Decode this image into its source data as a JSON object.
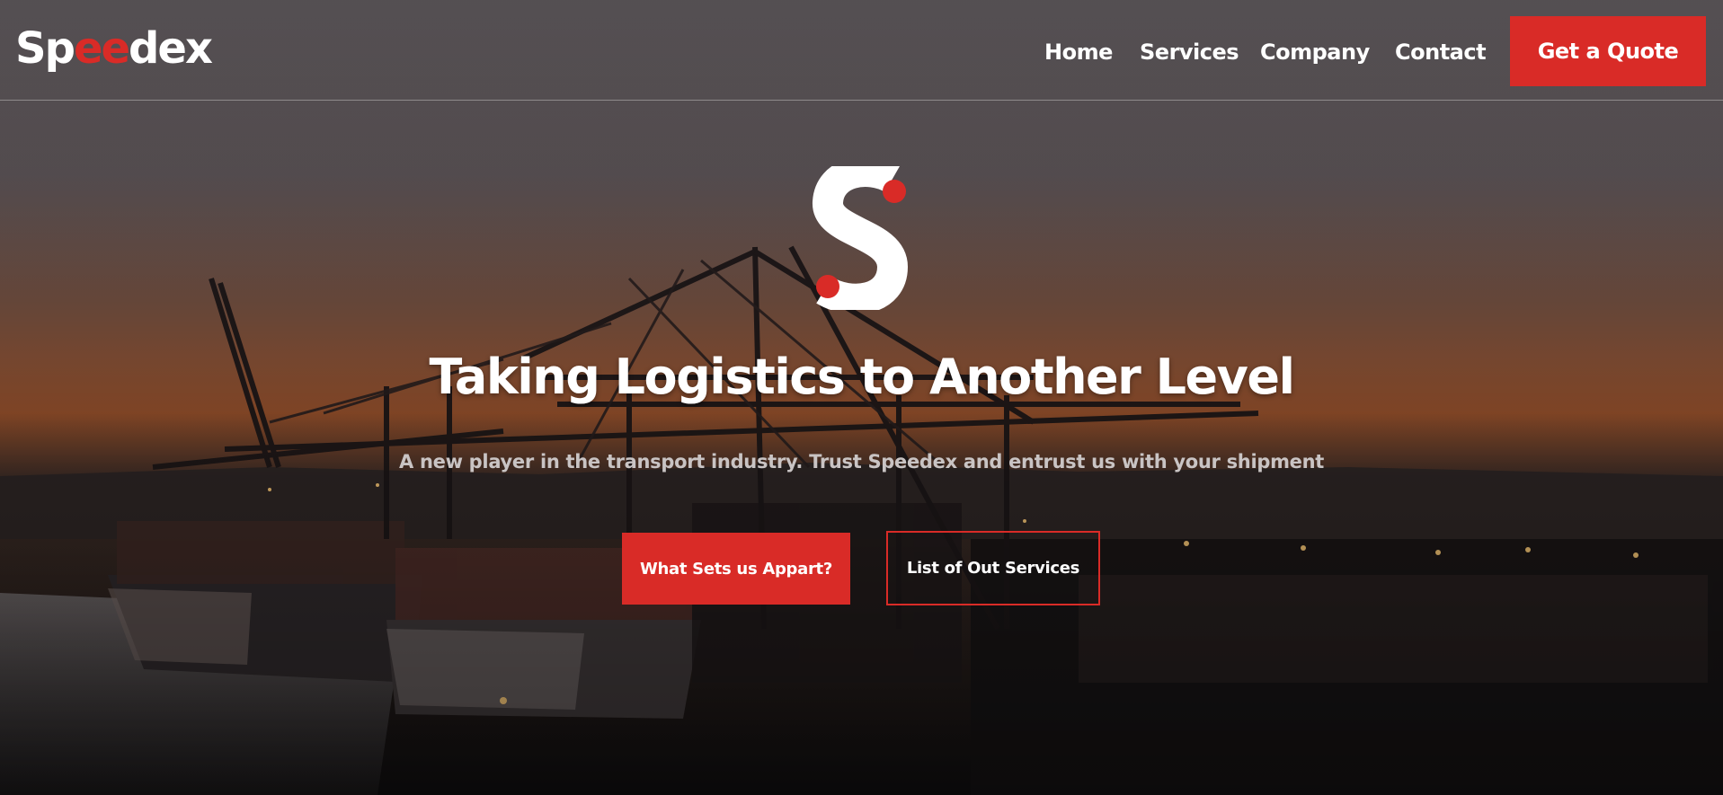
{
  "brand": {
    "name_start": "Sp",
    "name_accent": "ee",
    "name_end": "dex"
  },
  "nav": {
    "items": [
      {
        "label": "Home"
      },
      {
        "label": "Services"
      },
      {
        "label": "Company"
      },
      {
        "label": "Contact"
      }
    ],
    "cta_label": "Get a Quote"
  },
  "hero": {
    "title": "Taking Logistics to Another Level",
    "subtitle": "A new player in the transport industry. Trust Speedex and entrust us with your shipment",
    "primary_button": "What Sets us Appart?",
    "secondary_button": "List of Out Services"
  },
  "colors": {
    "accent": "#d92b27",
    "text": "#ffffff",
    "subtitle": "#c9c4c4"
  },
  "icons": {
    "logo_mark": "speedex-s-logo-icon"
  }
}
